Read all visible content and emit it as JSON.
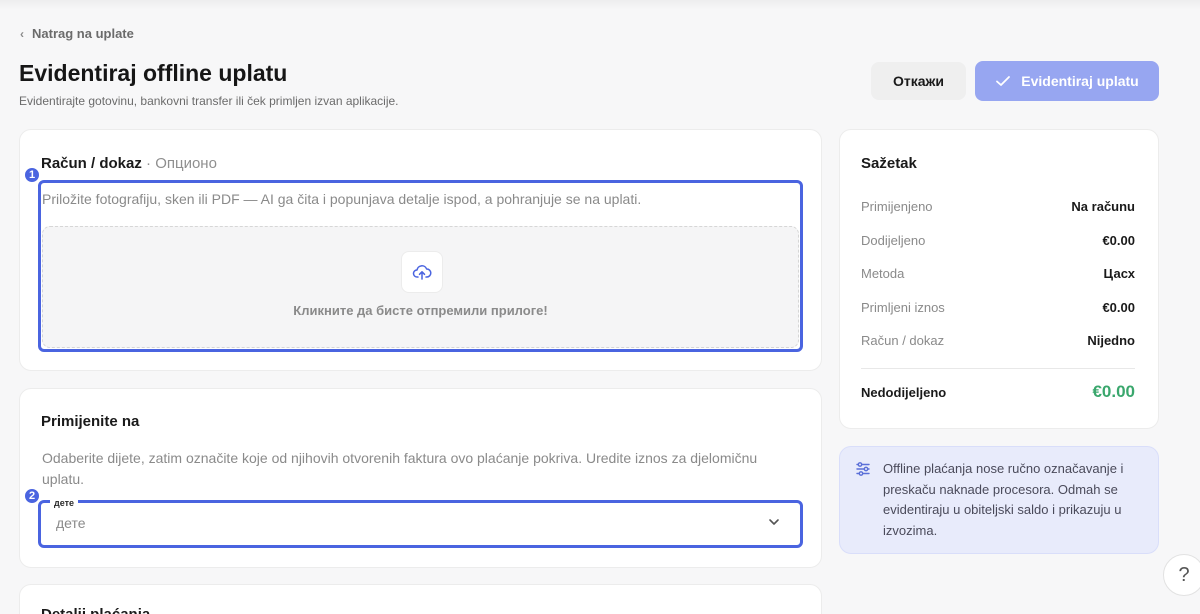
{
  "nav": {
    "back_label": "Natrag na uplate"
  },
  "header": {
    "title": "Evidentiraj offline uplatu",
    "subtitle": "Evidentirajte gotovinu, bankovni transfer ili ček primljen izvan aplikacije.",
    "cancel_label": "Откажи",
    "submit_label": "Evidentiraj uplatu"
  },
  "receipt": {
    "title": "Račun / dokaz",
    "optional": "· Опционо",
    "badge": "1",
    "hint": "Priložite fotografiju, sken ili PDF — AI ga čita i popunjava detalje ispod, a pohranjuje se na uplati.",
    "dropzone_text": "Кликните да бисте отпремили прилоге!"
  },
  "apply": {
    "title": "Primijenite na",
    "badge": "2",
    "hint": "Odaberite dijete, zatim označite koje od njihovih otvorenih faktura ovo plaćanje pokriva. Uredite iznos za djelomičnu uplatu.",
    "select_label": "дете",
    "select_placeholder": "дете"
  },
  "details": {
    "title": "Detalji plaćanja"
  },
  "summary": {
    "title": "Sažetak",
    "rows": [
      {
        "label": "Primijenjeno",
        "value": "Na računu"
      },
      {
        "label": "Dodijeljeno",
        "value": "€0.00"
      },
      {
        "label": "Metoda",
        "value": "Цасх"
      },
      {
        "label": "Primljeni iznos",
        "value": "€0.00"
      },
      {
        "label": "Račun / dokaz",
        "value": "Nijedno"
      }
    ],
    "total_label": "Nedodijeljeno",
    "total_value": "€0.00"
  },
  "info": {
    "text": "Offline plaćanja nose ručno označavanje i preskaču naknade procesora. Odmah se evidentiraju u obiteljski saldo i prikazuju u izvozima."
  },
  "help": {
    "label": "?"
  },
  "colors": {
    "accent": "#4a64e0",
    "submit_bg": "#97a6f1",
    "total_green": "#3aa76d",
    "info_bg": "#e8ebfb"
  }
}
